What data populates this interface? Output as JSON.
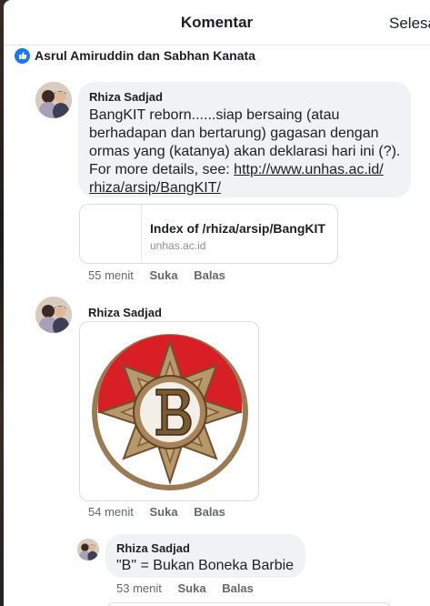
{
  "header": {
    "title": "Komentar",
    "done_label": "Selesai"
  },
  "likes": {
    "names": "Asrul Amiruddin dan Sabhan Kanata",
    "icon": "thumbs-up-icon"
  },
  "comments": [
    {
      "author": "Rhiza Sadjad",
      "text_lines": [
        "BangKIT reborn......siap bersaing (atau",
        "berhadapan dan bertarung) gagasan dengan",
        "ormas yang (katanya) akan deklarasi hari ini (?).",
        "For more details, see: "
      ],
      "link_part1": "http://www.unhas.ac.id/",
      "link_part2": "rhiza/arsip/BangKIT/",
      "preview": {
        "title": "Index of /rhiza/arsip/BangKIT",
        "domain": "unhas.ac.id"
      },
      "time": "55 menit",
      "like_label": "Suka",
      "reply_label": "Balas"
    },
    {
      "author": "Rhiza Sadjad",
      "image": "bangkit-emblem-logo",
      "time": "54 menit",
      "like_label": "Suka",
      "reply_label": "Balas"
    },
    {
      "author": "Rhiza Sadjad",
      "text": "\"B\" = Bukan Boneka Barbie",
      "time": "53 menit",
      "like_label": "Suka",
      "reply_label": "Balas"
    }
  ],
  "colors": {
    "accent": "#1877f2",
    "bubble": "#f0f2f5",
    "emblem_red": "#d91f26",
    "emblem_bronze": "#9a7a52"
  }
}
